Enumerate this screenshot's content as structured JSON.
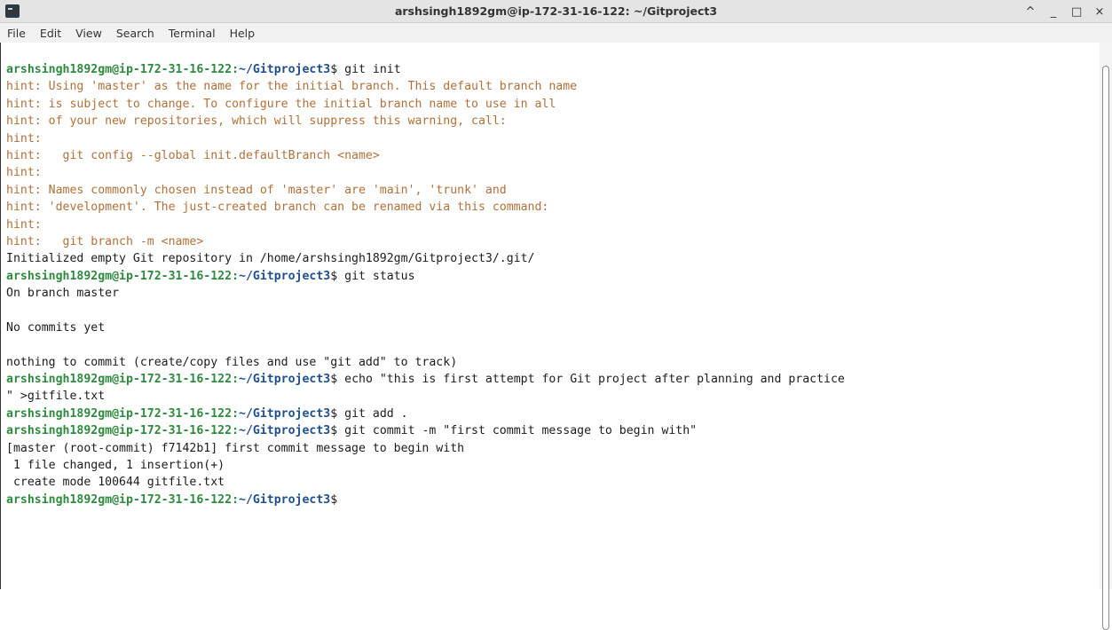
{
  "window": {
    "title": "arshsingh1892gm@ip-172-31-16-122: ~/Gitproject3",
    "controls": {
      "up": "^",
      "minimize": "_",
      "maximize": "□",
      "close": "×"
    }
  },
  "menu": [
    "File",
    "Edit",
    "View",
    "Search",
    "Terminal",
    "Help"
  ],
  "terminal": {
    "prompt_user": "arshsingh1892gm@ip-172-31-16-122",
    "prompt_path": "~/Gitproject3",
    "lines": [
      {
        "type": "cmd",
        "cmd": "git init"
      },
      {
        "type": "hint",
        "text": "hint: Using 'master' as the name for the initial branch. This default branch name"
      },
      {
        "type": "hint",
        "text": "hint: is subject to change. To configure the initial branch name to use in all"
      },
      {
        "type": "hint",
        "text": "hint: of your new repositories, which will suppress this warning, call:"
      },
      {
        "type": "hint",
        "text": "hint:"
      },
      {
        "type": "hint",
        "text": "hint:   git config --global init.defaultBranch <name>"
      },
      {
        "type": "hint",
        "text": "hint:"
      },
      {
        "type": "hint",
        "text": "hint: Names commonly chosen instead of 'master' are 'main', 'trunk' and"
      },
      {
        "type": "hint",
        "text": "hint: 'development'. The just-created branch can be renamed via this command:"
      },
      {
        "type": "hint",
        "text": "hint:"
      },
      {
        "type": "hint",
        "text": "hint:   git branch -m <name>"
      },
      {
        "type": "out",
        "text": "Initialized empty Git repository in /home/arshsingh1892gm/Gitproject3/.git/"
      },
      {
        "type": "cmd",
        "cmd": "git status"
      },
      {
        "type": "out",
        "text": "On branch master"
      },
      {
        "type": "out",
        "text": ""
      },
      {
        "type": "out",
        "text": "No commits yet"
      },
      {
        "type": "out",
        "text": ""
      },
      {
        "type": "out",
        "text": "nothing to commit (create/copy files and use \"git add\" to track)"
      },
      {
        "type": "cmd",
        "cmd": "echo \"this is first attempt for Git project after planning and practice"
      },
      {
        "type": "out",
        "text": "\" >gitfile.txt"
      },
      {
        "type": "cmd",
        "cmd": "git add ."
      },
      {
        "type": "cmd",
        "cmd": "git commit -m \"first commit message to begin with\""
      },
      {
        "type": "out",
        "text": "[master (root-commit) f7142b1] first commit message to begin with"
      },
      {
        "type": "out",
        "text": " 1 file changed, 1 insertion(+)"
      },
      {
        "type": "out",
        "text": " create mode 100644 gitfile.txt"
      },
      {
        "type": "cmd",
        "cmd": ""
      }
    ]
  }
}
